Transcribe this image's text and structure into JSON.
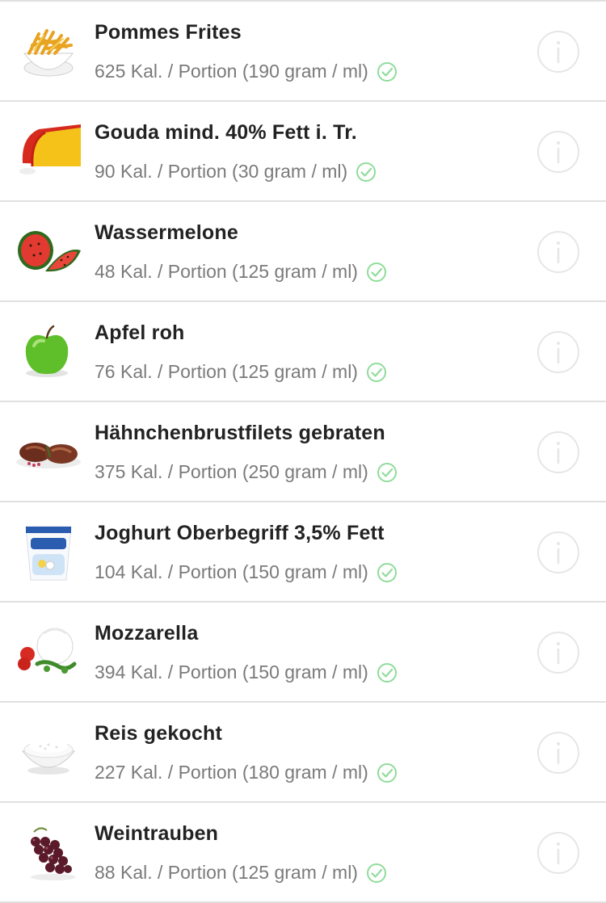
{
  "foods": [
    {
      "name": "Pommes Frites",
      "calories": "625 Kal. / Portion (190 gram / ml)",
      "image": "fries-icon",
      "verified": true
    },
    {
      "name": "Gouda mind. 40% Fett i. Tr.",
      "calories": "90 Kal. / Portion (30 gram / ml)",
      "image": "cheese-icon",
      "verified": true
    },
    {
      "name": "Wassermelone",
      "calories": "48 Kal. / Portion (125 gram / ml)",
      "image": "watermelon-icon",
      "verified": true
    },
    {
      "name": "Apfel roh",
      "calories": "76 Kal. / Portion (125 gram / ml)",
      "image": "apple-icon",
      "verified": true
    },
    {
      "name": "Hähnchenbrustfilets gebraten",
      "calories": "375 Kal. / Portion (250 gram / ml)",
      "image": "chicken-icon",
      "verified": true
    },
    {
      "name": "Joghurt Oberbegriff 3,5% Fett",
      "calories": "104 Kal. / Portion (150 gram / ml)",
      "image": "yogurt-icon",
      "verified": true
    },
    {
      "name": "Mozzarella",
      "calories": "394 Kal. / Portion (150 gram / ml)",
      "image": "mozzarella-icon",
      "verified": true
    },
    {
      "name": "Reis gekocht",
      "calories": "227 Kal. / Portion (180 gram / ml)",
      "image": "rice-icon",
      "verified": true
    },
    {
      "name": "Weintrauben",
      "calories": "88 Kal. / Portion (125 gram / ml)",
      "image": "grapes-icon",
      "verified": true
    }
  ],
  "colors": {
    "verified_check": "#8fdc9a",
    "info_icon": "#e6e6e6",
    "divider": "#e0e0e0",
    "title_text": "#222222",
    "subtitle_text": "#7a7a7a"
  }
}
